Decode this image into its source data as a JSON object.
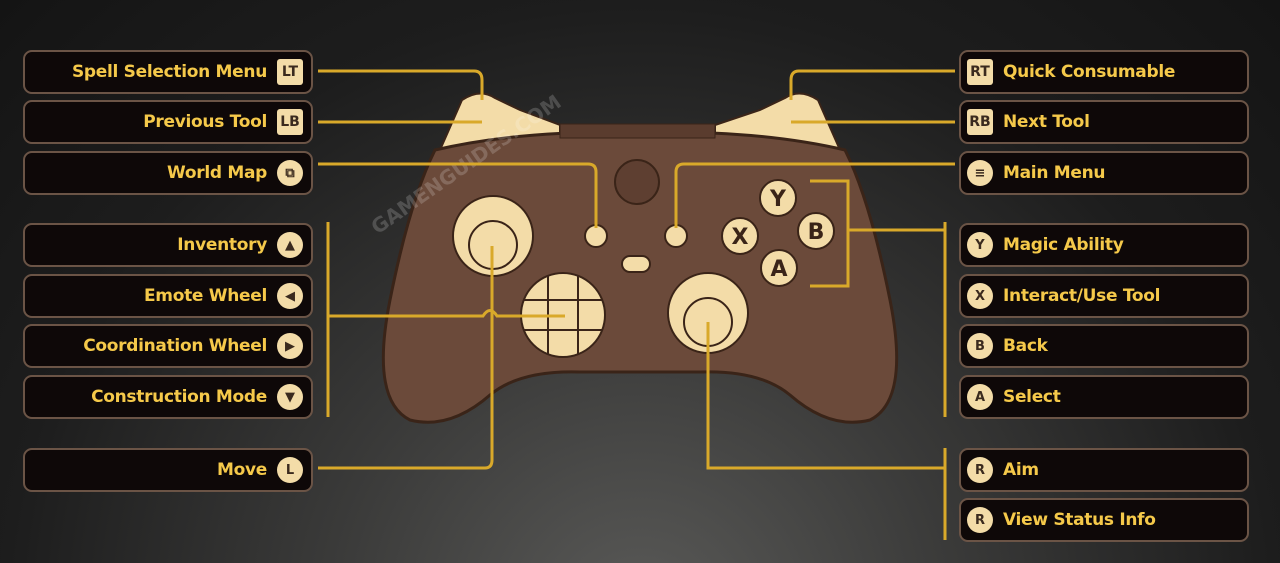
{
  "left": [
    {
      "label": "Spell Selection Menu",
      "icon": "lt-trigger-icon",
      "glyph": "LT",
      "shape": "sq"
    },
    {
      "label": "Previous Tool",
      "icon": "lb-bumper-icon",
      "glyph": "LB",
      "shape": "sq"
    },
    {
      "label": "World Map",
      "icon": "view-button-icon",
      "glyph": "⧉",
      "shape": "c"
    },
    {
      "label": "Inventory",
      "icon": "dpad-up-icon",
      "glyph": "▲",
      "shape": "c"
    },
    {
      "label": "Emote Wheel",
      "icon": "dpad-left-icon",
      "glyph": "◀",
      "shape": "c"
    },
    {
      "label": "Coordination Wheel",
      "icon": "dpad-right-icon",
      "glyph": "▶",
      "shape": "c"
    },
    {
      "label": "Construction Mode",
      "icon": "dpad-down-icon",
      "glyph": "▼",
      "shape": "c"
    },
    {
      "label": "Move",
      "icon": "left-stick-icon",
      "glyph": "L",
      "shape": "c"
    }
  ],
  "right": [
    {
      "label": "Quick Consumable",
      "icon": "rt-trigger-icon",
      "glyph": "RT",
      "shape": "sq"
    },
    {
      "label": "Next Tool",
      "icon": "rb-bumper-icon",
      "glyph": "RB",
      "shape": "sq"
    },
    {
      "label": "Main Menu",
      "icon": "menu-button-icon",
      "glyph": "≡",
      "shape": "c"
    },
    {
      "label": "Magic Ability",
      "icon": "y-button-icon",
      "glyph": "Y",
      "shape": "c"
    },
    {
      "label": "Interact/Use Tool",
      "icon": "x-button-icon",
      "glyph": "X",
      "shape": "c"
    },
    {
      "label": "Back",
      "icon": "b-button-icon",
      "glyph": "B",
      "shape": "c"
    },
    {
      "label": "Select",
      "icon": "a-button-icon",
      "glyph": "A",
      "shape": "c"
    },
    {
      "label": "Aim",
      "icon": "right-stick-icon",
      "glyph": "R",
      "shape": "c"
    },
    {
      "label": "View Status Info",
      "icon": "right-stick-press-icon",
      "glyph": "R",
      "shape": "c"
    }
  ],
  "controller": {
    "face": [
      "Y",
      "X",
      "B",
      "A"
    ]
  },
  "watermark": "GAMENGUIDES.COM",
  "colors": {
    "text": "#f5c94a",
    "line": "#d9a92a",
    "controller": "#6b4a3a",
    "button": "#f3dca8"
  }
}
